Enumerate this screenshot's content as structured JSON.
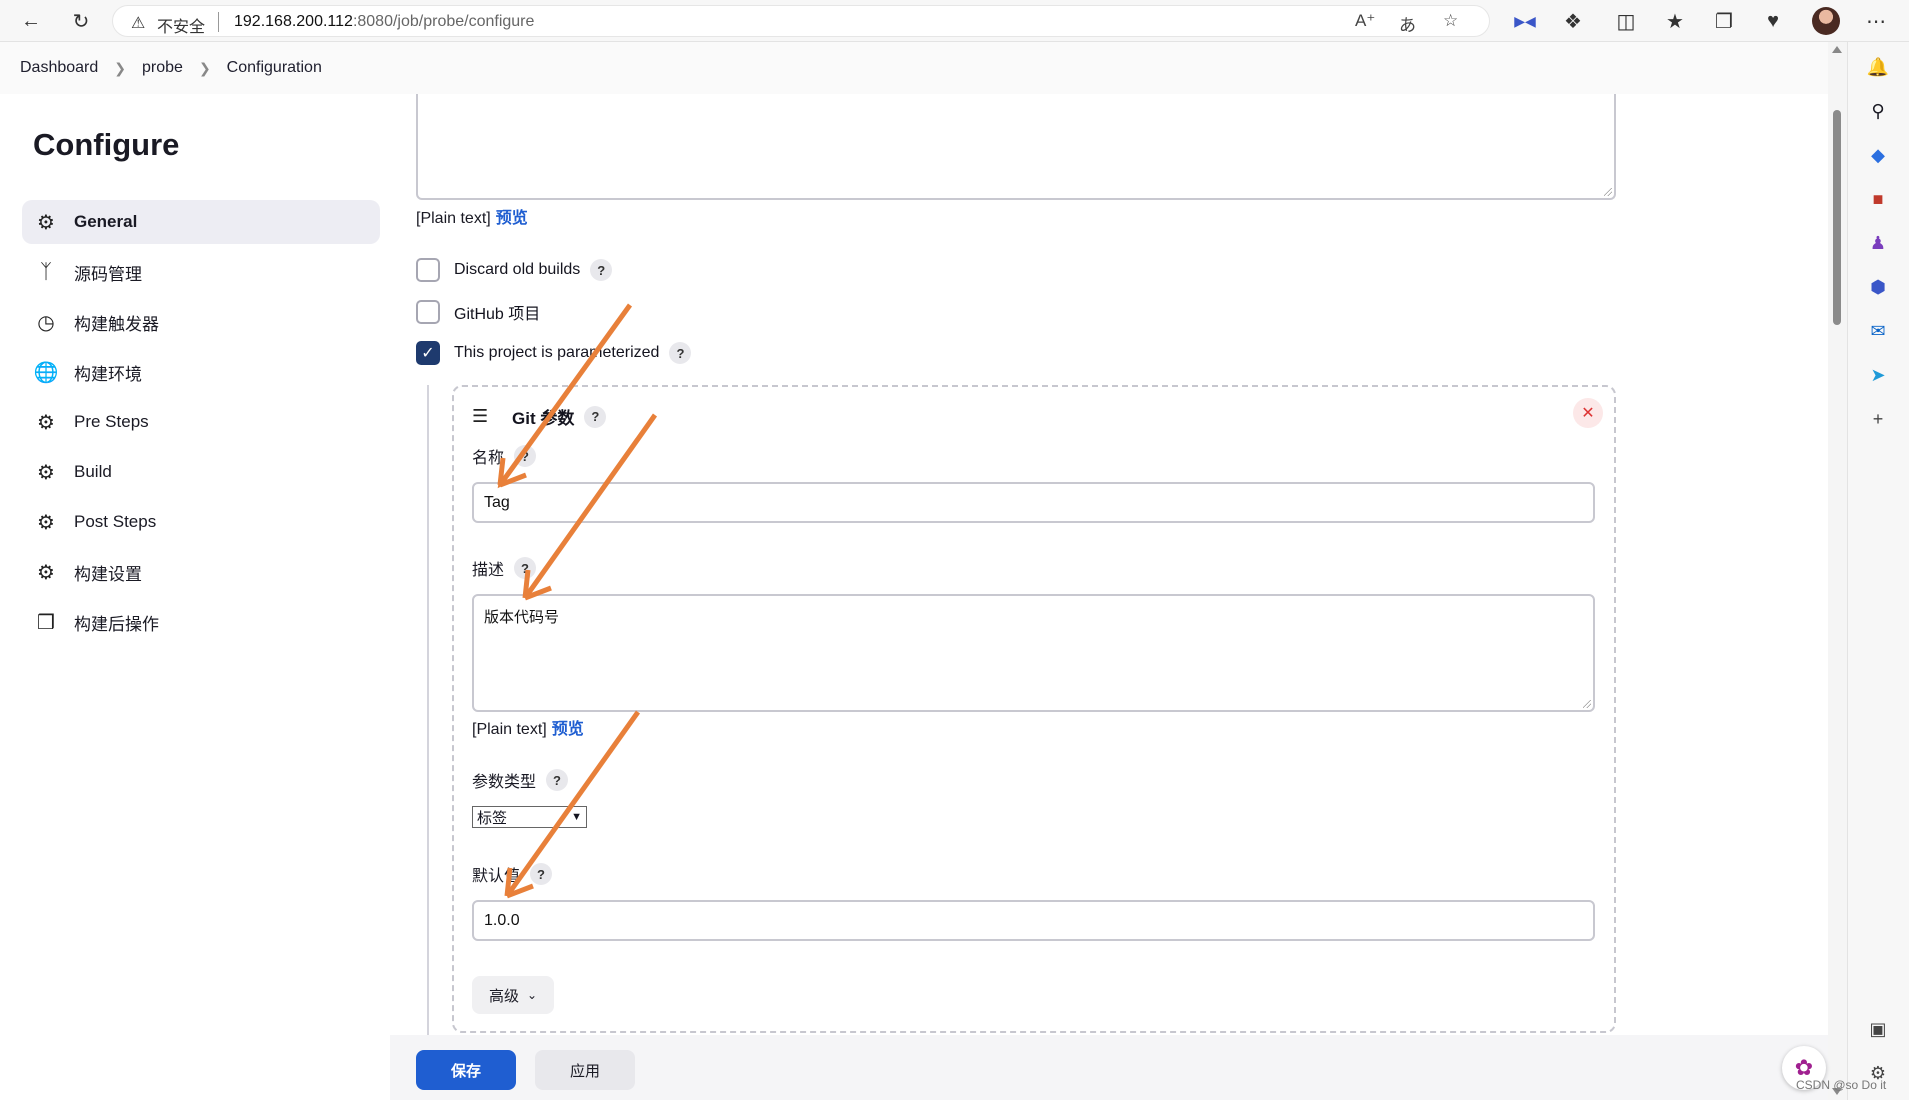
{
  "browser": {
    "warning_text": "不安全",
    "url_host": "192.168.200.112",
    "url_rest": ":8080/job/probe/configure",
    "icons": [
      "back-icon",
      "refresh-icon",
      "read-aloud-icon",
      "translate-icon",
      "favorite-star-icon",
      "extension-icon",
      "puzzle-icon",
      "split-screen-icon",
      "favorites-icon",
      "collections-icon",
      "health-icon",
      "profile-avatar",
      "more-icon"
    ]
  },
  "edge_sidebar": {
    "icons": [
      "bell-icon",
      "search-icon",
      "tag-icon",
      "toolbox-icon",
      "games-icon",
      "office-icon",
      "outlook-icon",
      "send-icon",
      "add-icon",
      "screenshot-icon",
      "settings-icon"
    ]
  },
  "breadcrumb": [
    "Dashboard",
    "probe",
    "Configuration"
  ],
  "page": {
    "title": "Configure"
  },
  "nav": {
    "items": [
      {
        "label": "General",
        "icon": "gear-icon",
        "active": true
      },
      {
        "label": "源码管理",
        "icon": "branch-icon"
      },
      {
        "label": "构建触发器",
        "icon": "clock-icon"
      },
      {
        "label": "构建环境",
        "icon": "globe-icon"
      },
      {
        "label": "Pre Steps",
        "icon": "gear-icon"
      },
      {
        "label": "Build",
        "icon": "gear-icon"
      },
      {
        "label": "Post Steps",
        "icon": "gear-icon"
      },
      {
        "label": "构建设置",
        "icon": "gear-icon"
      },
      {
        "label": "构建后操作",
        "icon": "cube-icon"
      }
    ]
  },
  "form": {
    "plain_text_label": "[Plain text]",
    "preview_link": "预览",
    "checkboxes": [
      {
        "label": "Discard old builds",
        "checked": false
      },
      {
        "label": "GitHub 项目",
        "checked": false
      },
      {
        "label": "This project is parameterized",
        "checked": true
      }
    ],
    "parameter": {
      "title": "Git 参数",
      "name_label": "名称",
      "name_value": "Tag",
      "desc_label": "描述",
      "desc_value": "版本代码号",
      "type_label": "参数类型",
      "type_selected": "标签",
      "default_label": "默认值",
      "default_value": "1.0.0",
      "advanced_label": "高级"
    }
  },
  "buttons": {
    "save": "保存",
    "apply": "应用"
  },
  "watermark": "CSDN @so Do it",
  "colors": {
    "primary": "#1f5ed1",
    "checkbox": "#1e3a6e",
    "annotation_arrow": "#e8803a"
  }
}
